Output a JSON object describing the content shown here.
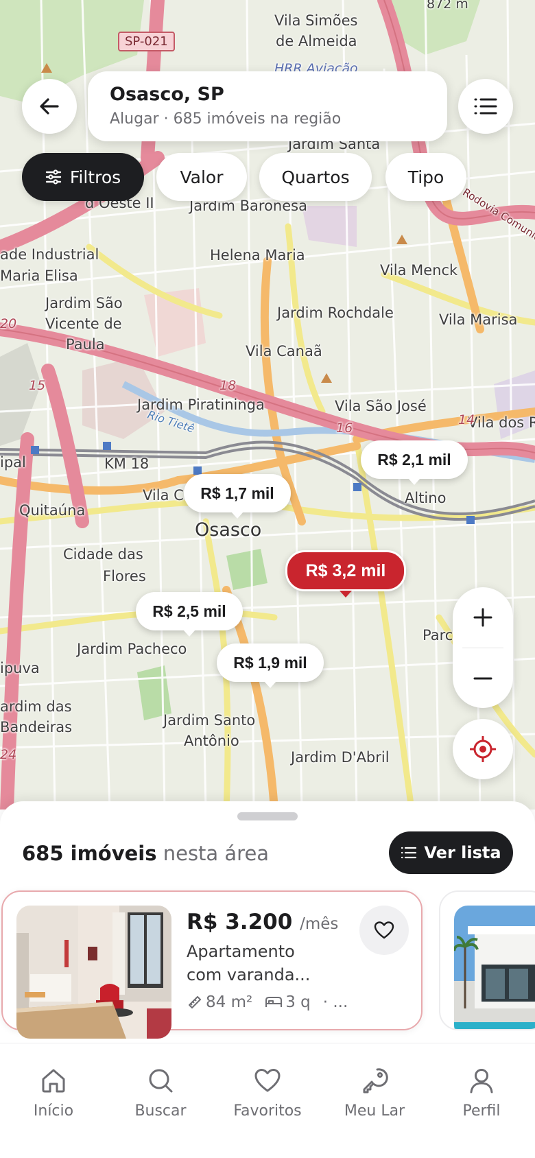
{
  "header": {
    "back_icon": "arrow-left-icon",
    "location_title": "Osasco, SP",
    "location_subtitle": "Alugar · 685 imóveis na região",
    "menu_icon": "list-icon"
  },
  "filters": [
    {
      "label": "Filtros",
      "icon": "sliders-icon",
      "active": true
    },
    {
      "label": "Valor",
      "active": false
    },
    {
      "label": "Quartos",
      "active": false
    },
    {
      "label": "Tipo",
      "active": false
    }
  ],
  "map": {
    "labels": [
      {
        "text": "Vila Simões"
      },
      {
        "text": "de Almeida"
      },
      {
        "text": "SP-021"
      },
      {
        "text": "872 m"
      },
      {
        "text": "HRR Aviação"
      },
      {
        "text": "Jardim Santa"
      },
      {
        "text": "Jardim Baronesa"
      },
      {
        "text": "d Oeste II"
      },
      {
        "text": "Rodovia Comunicador Silvio"
      },
      {
        "text": "ade Industrial"
      },
      {
        "text": "Maria Elisa"
      },
      {
        "text": "Helena Maria"
      },
      {
        "text": "Vila Menck"
      },
      {
        "text": "Jardim São"
      },
      {
        "text": "Vicente de"
      },
      {
        "text": "Paula"
      },
      {
        "text": "Jardim Rochdale"
      },
      {
        "text": "Vila Marisa"
      },
      {
        "text": "Vila Canaã"
      },
      {
        "text": "Jardim Piratininga"
      },
      {
        "text": "Vila São José"
      },
      {
        "text": "Vila dos R"
      },
      {
        "text": "Rio Tietê"
      },
      {
        "text": "ipal"
      },
      {
        "text": "KM 18"
      },
      {
        "text": "Vila C"
      },
      {
        "text": "Altino"
      },
      {
        "text": "Quitaúna"
      },
      {
        "text": "Osasco"
      },
      {
        "text": "Cidade das"
      },
      {
        "text": "Flores"
      },
      {
        "text": "Jardim Pacheco"
      },
      {
        "text": "Parc"
      },
      {
        "text": "ipuva"
      },
      {
        "text": "ardim das"
      },
      {
        "text": "Bandeiras"
      },
      {
        "text": "Jardim Santo"
      },
      {
        "text": "Antônio"
      },
      {
        "text": "Jardim D'Abril"
      },
      {
        "text": "18"
      },
      {
        "text": "15"
      },
      {
        "text": "16"
      },
      {
        "text": "14"
      },
      {
        "text": "24"
      },
      {
        "text": "20"
      }
    ],
    "pins": [
      {
        "label": "R$ 2,1 mil",
        "active": false
      },
      {
        "label": "R$ 1,7 mil",
        "active": false
      },
      {
        "label": "R$ 3,2 mil",
        "active": true
      },
      {
        "label": "R$ 2,5 mil",
        "active": false
      },
      {
        "label": "R$ 1,9 mil",
        "active": false
      }
    ],
    "controls": {
      "zoom_in_icon": "plus-icon",
      "zoom_out_icon": "minus-icon",
      "locate_icon": "crosshair-icon"
    }
  },
  "sheet": {
    "count_bold": "685 imóveis",
    "count_rest": "nesta área",
    "list_button": "Ver lista",
    "list_icon": "list-icon"
  },
  "listing": {
    "price": "R$ 3.200",
    "period": "/mês",
    "title_line1": "Apartamento",
    "title_line2": "com varanda...",
    "area": "84 m²",
    "rooms": "3 q",
    "more": "· ...",
    "favorite_icon": "heart-icon"
  },
  "nav": [
    {
      "label": "Início",
      "icon": "home-icon"
    },
    {
      "label": "Buscar",
      "icon": "search-icon"
    },
    {
      "label": "Favoritos",
      "icon": "heart-icon"
    },
    {
      "label": "Meu Lar",
      "icon": "key-icon"
    },
    {
      "label": "Perfil",
      "icon": "user-icon"
    }
  ],
  "colors": {
    "accent": "#c9252e",
    "dark": "#1d1e21",
    "muted_text": "#6e6e73"
  }
}
